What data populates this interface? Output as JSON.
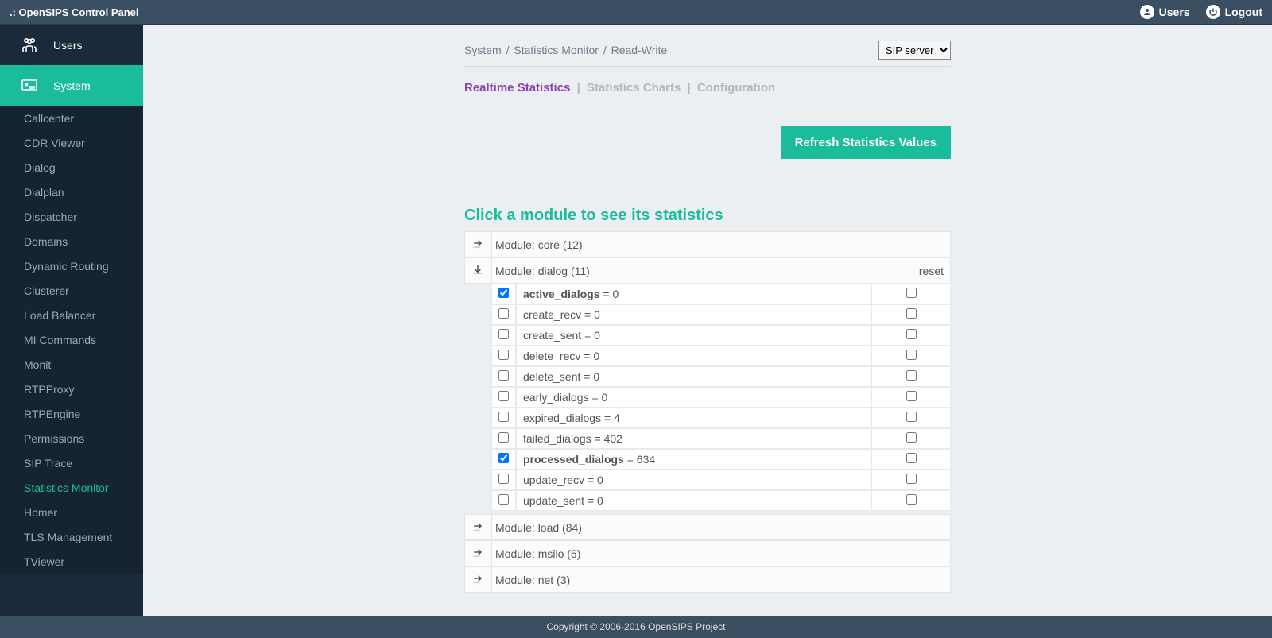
{
  "header": {
    "brand": ".: OpenSIPS Control Panel",
    "links": {
      "users": "Users",
      "logout": "Logout"
    }
  },
  "sidebar": {
    "categories": [
      {
        "label": "Users",
        "kind": "users"
      },
      {
        "label": "System",
        "kind": "system",
        "active": true
      }
    ],
    "system_items": [
      {
        "label": "Callcenter"
      },
      {
        "label": "CDR Viewer"
      },
      {
        "label": "Dialog"
      },
      {
        "label": "Dialplan"
      },
      {
        "label": "Dispatcher"
      },
      {
        "label": "Domains"
      },
      {
        "label": "Dynamic Routing"
      },
      {
        "label": "Clusterer"
      },
      {
        "label": "Load Balancer"
      },
      {
        "label": "MI Commands"
      },
      {
        "label": "Monit"
      },
      {
        "label": "RTPProxy"
      },
      {
        "label": "RTPEngine"
      },
      {
        "label": "Permissions"
      },
      {
        "label": "SIP Trace"
      },
      {
        "label": "Statistics Monitor",
        "active": true
      },
      {
        "label": "Homer"
      },
      {
        "label": "TLS Management"
      },
      {
        "label": "TViewer"
      }
    ]
  },
  "breadcrumb": {
    "p0": "System",
    "p1": "Statistics Monitor",
    "p2": "Read-Write",
    "sep": "/"
  },
  "system_select": {
    "value": "SIP server"
  },
  "tabs": {
    "t0": "Realtime Statistics",
    "t1": "Statistics Charts",
    "t2": "Configuration",
    "pipe": "|"
  },
  "buttons": {
    "refresh": "Refresh Statistics Values"
  },
  "heading": "Click a module to see its statistics",
  "modules": [
    {
      "label": "Module: core (12)",
      "expanded": false
    },
    {
      "label": "Module: dialog (11)",
      "expanded": true,
      "reset": "reset",
      "stats": [
        {
          "name": "active_dialogs",
          "value": "0",
          "checked": true,
          "bold": true
        },
        {
          "name": "create_recv",
          "value": "0",
          "checked": false
        },
        {
          "name": "create_sent",
          "value": "0",
          "checked": false
        },
        {
          "name": "delete_recv",
          "value": "0",
          "checked": false
        },
        {
          "name": "delete_sent",
          "value": "0",
          "checked": false
        },
        {
          "name": "early_dialogs",
          "value": "0",
          "checked": false
        },
        {
          "name": "expired_dialogs",
          "value": "4",
          "checked": false
        },
        {
          "name": "failed_dialogs",
          "value": "402",
          "checked": false
        },
        {
          "name": "processed_dialogs",
          "value": "634",
          "checked": true,
          "bold": true
        },
        {
          "name": "update_recv",
          "value": "0",
          "checked": false
        },
        {
          "name": "update_sent",
          "value": "0",
          "checked": false
        }
      ]
    },
    {
      "label": "Module: load (84)",
      "expanded": false
    },
    {
      "label": "Module: msilo (5)",
      "expanded": false
    },
    {
      "label": "Module: net (3)",
      "expanded": false
    }
  ],
  "footer": "Copyright © 2006-2016 OpenSIPS Project"
}
